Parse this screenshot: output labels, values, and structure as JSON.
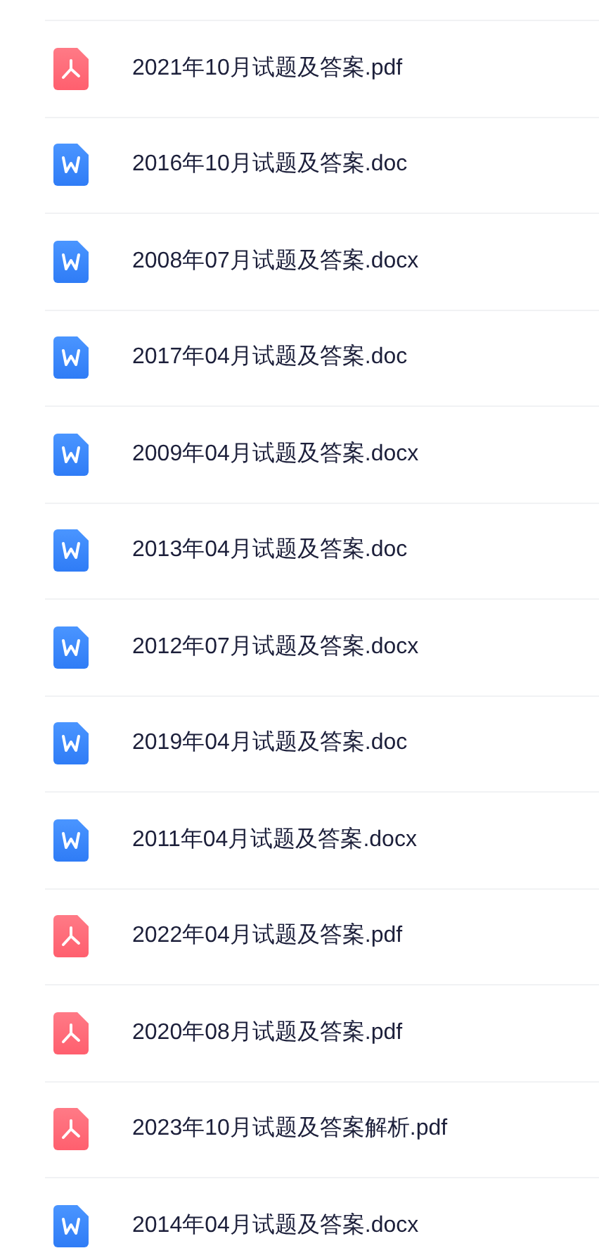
{
  "files": [
    {
      "kind": "pdf",
      "name": "2021年10月试题及答案.pdf"
    },
    {
      "kind": "word",
      "name": "2016年10月试题及答案.doc"
    },
    {
      "kind": "word",
      "name": "2008年07月试题及答案.docx"
    },
    {
      "kind": "word",
      "name": "2017年04月试题及答案.doc"
    },
    {
      "kind": "word",
      "name": "2009年04月试题及答案.docx"
    },
    {
      "kind": "word",
      "name": "2013年04月试题及答案.doc"
    },
    {
      "kind": "word",
      "name": "2012年07月试题及答案.docx"
    },
    {
      "kind": "word",
      "name": "2019年04月试题及答案.doc"
    },
    {
      "kind": "word",
      "name": "2011年04月试题及答案.docx"
    },
    {
      "kind": "pdf",
      "name": "2022年04月试题及答案.pdf"
    },
    {
      "kind": "pdf",
      "name": "2020年08月试题及答案.pdf"
    },
    {
      "kind": "pdf",
      "name": "2023年10月试题及答案解析.pdf"
    },
    {
      "kind": "word",
      "name": "2014年04月试题及答案.docx"
    }
  ]
}
